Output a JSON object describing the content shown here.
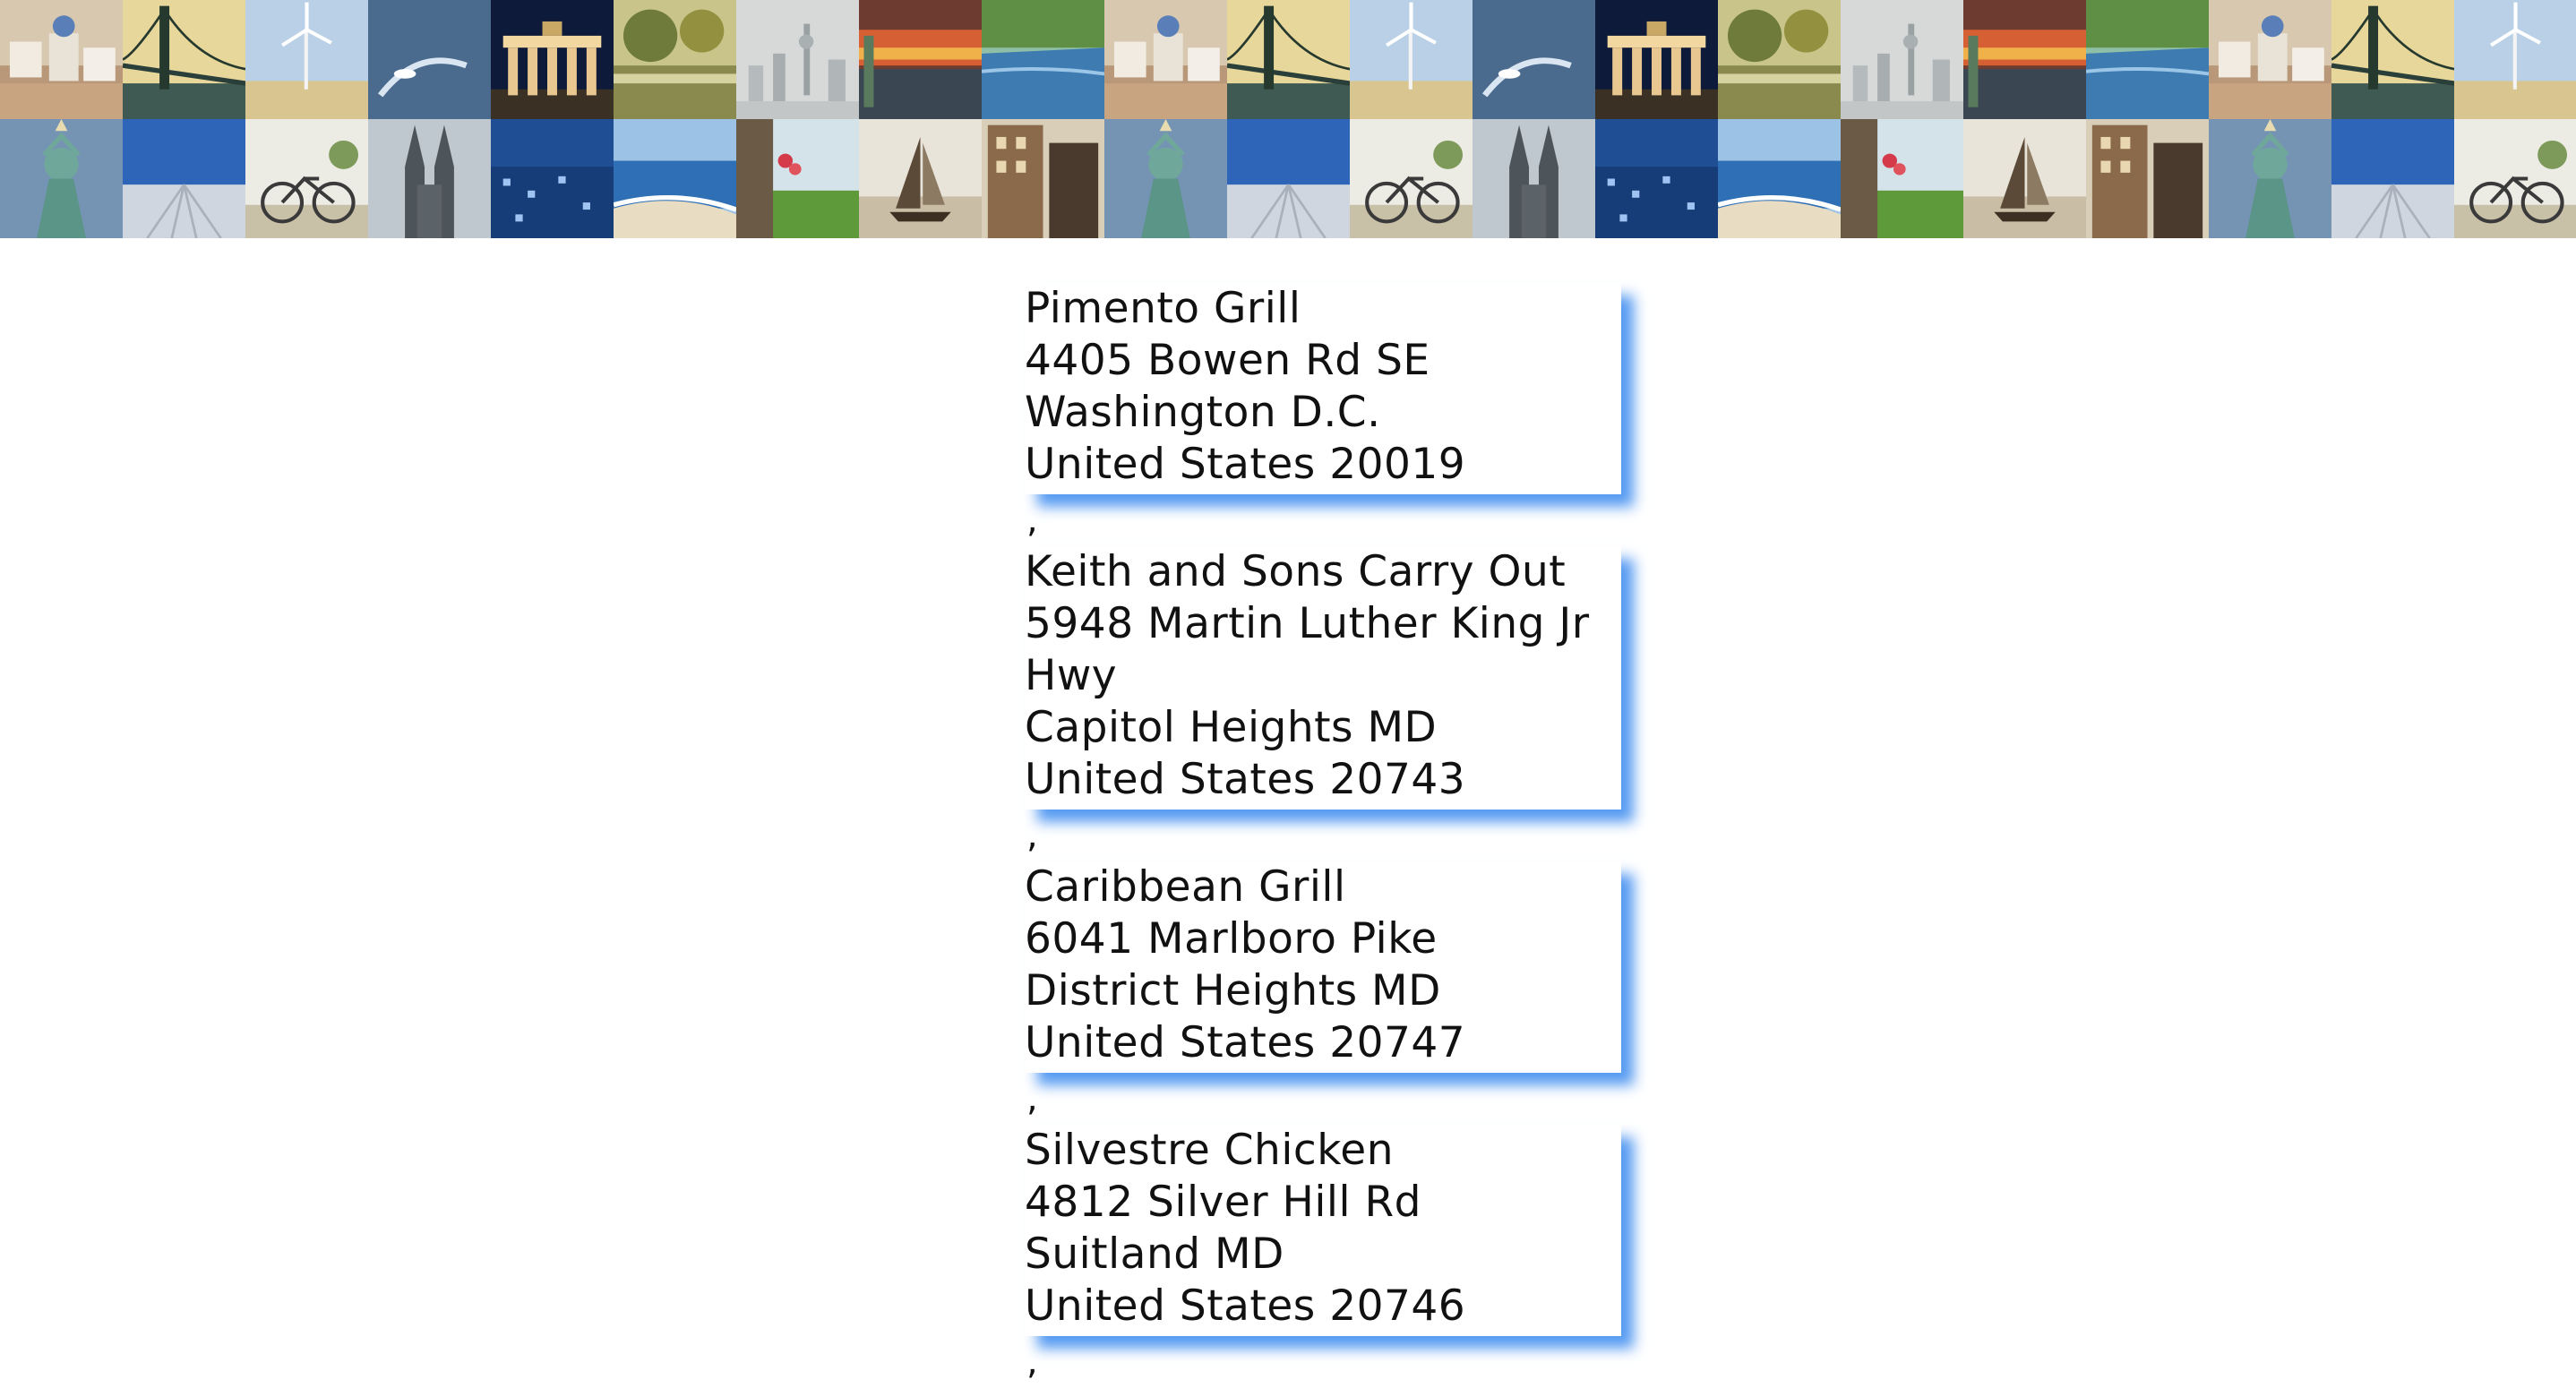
{
  "banner": {
    "tiles_top": [
      "village-photo",
      "bridge-photo",
      "windmill-photo",
      "boat-photo",
      "gate-photo",
      "lake-photo",
      "city-skyline-photo",
      "train-photo",
      "river-photo",
      "village-photo",
      "bridge-photo",
      "windmill-photo",
      "boat-photo",
      "gate-photo",
      "lake-photo",
      "city-skyline-photo",
      "train-photo",
      "river-photo",
      "village-photo",
      "bridge-photo",
      "windmill-photo"
    ],
    "tiles_bottom": [
      "statue-photo",
      "pier-photo",
      "bicycle-photo",
      "cathedral-photo",
      "night-city-photo",
      "beach-photo",
      "flower-photo",
      "sailboat-photo",
      "building-photo",
      "statue-photo",
      "pier-photo",
      "bicycle-photo",
      "cathedral-photo",
      "night-city-photo",
      "beach-photo",
      "flower-photo",
      "sailboat-photo",
      "building-photo",
      "statue-photo",
      "pier-photo",
      "bicycle-photo"
    ]
  },
  "restaurants": [
    {
      "lines": [
        "Pimento Grill",
        "4405 Bowen Rd SE",
        "Washington D.C.",
        "United States 20019"
      ]
    },
    {
      "lines": [
        "Keith and Sons Carry Out",
        "5948 Martin Luther King Jr",
        "Hwy",
        "Capitol Heights MD",
        "United States 20743"
      ]
    },
    {
      "lines": [
        "Caribbean Grill",
        "6041 Marlboro Pike",
        "District Heights MD",
        "United States 20747"
      ]
    },
    {
      "lines": [
        "Silvestre Chicken",
        "4812 Silver Hill Rd",
        "Suitland MD",
        "United States 20746"
      ]
    }
  ],
  "separator": ",",
  "colors": {
    "shadow": "#4e96f0",
    "background": "#ffffff"
  }
}
